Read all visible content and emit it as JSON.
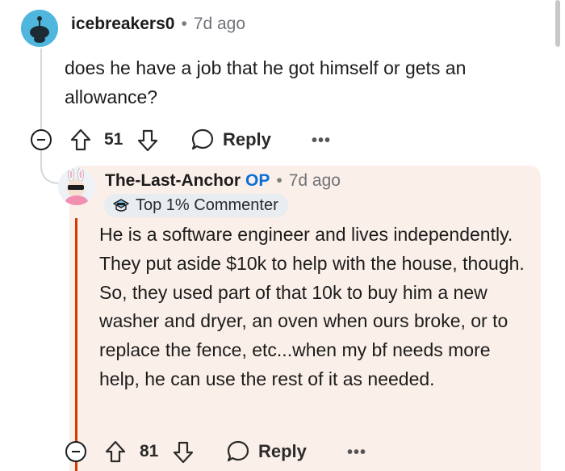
{
  "comment1": {
    "username": "icebreakers0",
    "separator": "•",
    "time": "7d ago",
    "body": "does he have a job that he got himself or gets an allowance?",
    "votes": "51",
    "reply_label": "Reply",
    "more_label": "•••"
  },
  "comment2": {
    "username": "The-Last-Anchor",
    "op_badge": "OP",
    "separator": "•",
    "time": "7d ago",
    "flair": "Top 1% Commenter",
    "body": "He is a software engineer and lives independently. They put aside $10k to help with the house, though. So, they used part of that 10k to buy him a new washer and dryer, an oven when ours broke, or to replace the fence, etc...when my bf needs more help, he can use the rest of it as needed.",
    "votes": "81",
    "reply_label": "Reply",
    "more_label": "•••"
  },
  "colors": {
    "op_accent": "#d93a00",
    "op_badge": "#0a6fd6",
    "op_background": "#fbefe9",
    "avatar1": "#4fb6dd"
  },
  "icons": [
    "upvote-icon",
    "downvote-icon",
    "reply-icon",
    "more-icon",
    "collapse-icon",
    "flair-icon"
  ]
}
